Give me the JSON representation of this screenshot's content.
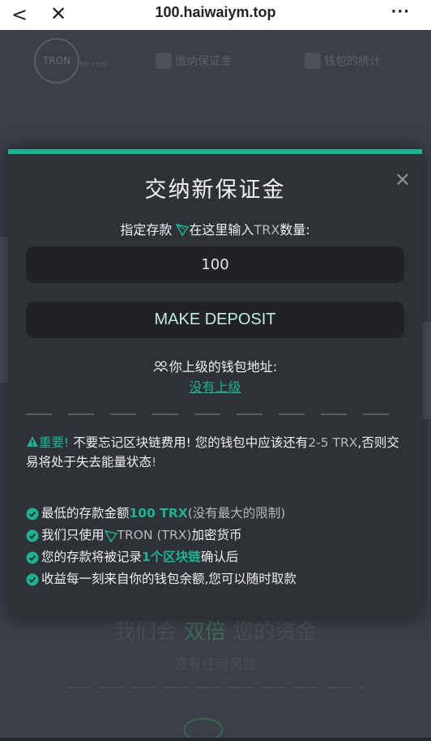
{
  "browser": {
    "back": "<",
    "close": "✕",
    "url": "100.haiwaiym.top",
    "more": "···"
  },
  "background": {
    "logo_text": "TRON",
    "logo_sub": "for com",
    "nav_deposit": "缴纳保证金",
    "nav_stats": "钱包的统计",
    "headline_1": "我们会 ",
    "headline_hl": "双倍",
    "headline_2": " 您的资金",
    "subline": "没有任何风险"
  },
  "modal": {
    "title": "交纳新保证金",
    "prompt_1": "指定存款 ",
    "prompt_2": "在这里输入",
    "prompt_unit": "TRX",
    "prompt_3": "数量:",
    "amount_value": "100",
    "deposit_button": "MAKE DEPOSIT",
    "upline_label": "你上级的钱包地址:",
    "upline_link": "没有上级",
    "warning_imp": "重要!",
    "warning_1": " 不要忘记区块链费用! 您的钱包中应该还有",
    "warning_range": "2-5 TRX",
    "warning_2": ",否则交易将处于失去能量状态",
    "warning_3": "!",
    "features": {
      "f1_a": "最低的存款金额 ",
      "f1_b": "100 TRX",
      "f1_c": "(没有最大的限制)",
      "f2_a": "我们只使用 ",
      "f2_b": "TRON (TRX)",
      "f2_c": " 加密货币",
      "f3_a": "您的存款将被记录 ",
      "f3_b": "1个区块链",
      "f3_c": " 确认后",
      "f4_a": "收益每一刻来自你的钱包余额,您可以随时取款"
    }
  },
  "colors": {
    "accent": "#1ab394",
    "modal_bg": "#2e3136",
    "input_bg": "#202226"
  }
}
